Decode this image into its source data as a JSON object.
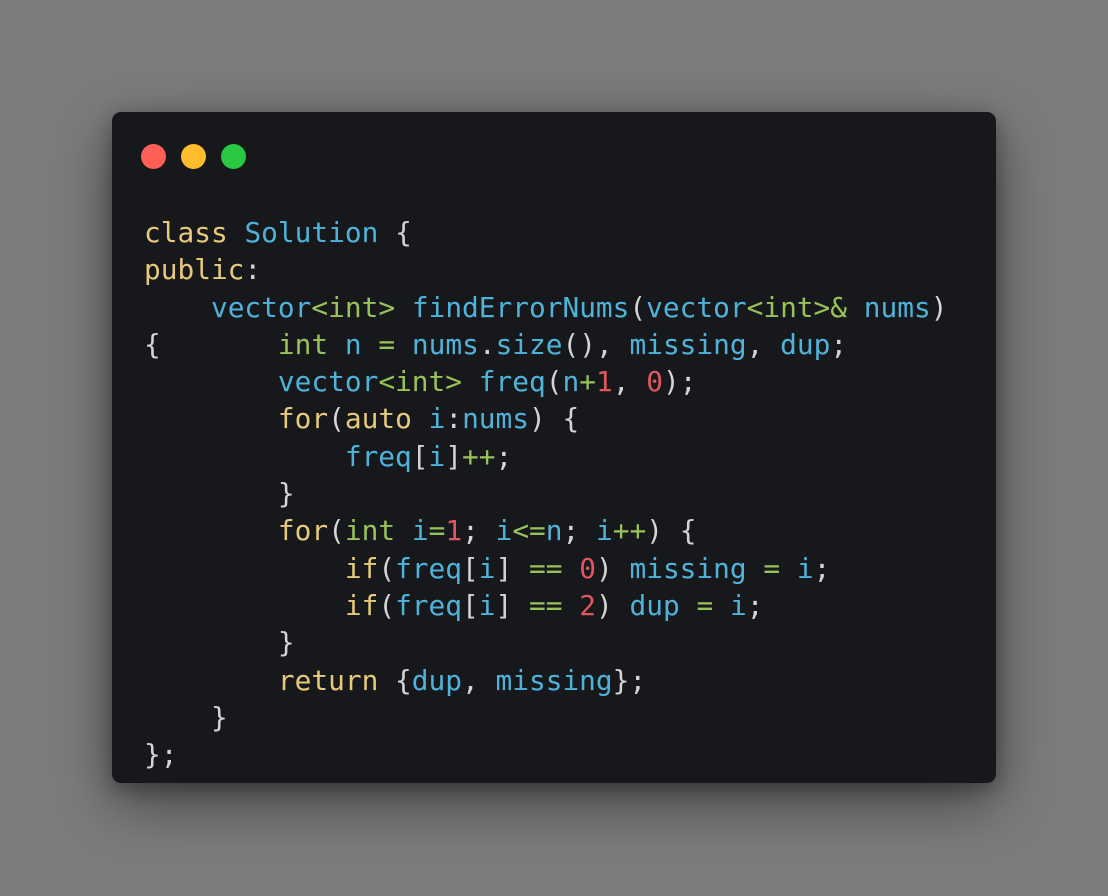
{
  "window": {
    "controls": [
      {
        "name": "close",
        "color": "#ff5f57"
      },
      {
        "name": "minimize",
        "color": "#febc2e"
      },
      {
        "name": "maximize",
        "color": "#28c840"
      }
    ]
  },
  "code": {
    "language": "cpp",
    "lines": [
      [
        [
          "kw",
          "class"
        ],
        [
          "pu",
          " "
        ],
        [
          "id",
          "Solution"
        ],
        [
          "pu",
          " {"
        ]
      ],
      [
        [
          "kw",
          "public"
        ],
        [
          "pu",
          ":"
        ]
      ],
      [
        [
          "pu",
          "    "
        ],
        [
          "id",
          "vector"
        ],
        [
          "op",
          "<"
        ],
        [
          "ty",
          "int"
        ],
        [
          "op",
          ">"
        ],
        [
          "pu",
          " "
        ],
        [
          "id",
          "findErrorNums"
        ],
        [
          "pu",
          "("
        ],
        [
          "id",
          "vector"
        ],
        [
          "op",
          "<"
        ],
        [
          "ty",
          "int"
        ],
        [
          "op",
          ">&"
        ],
        [
          "pu",
          " "
        ],
        [
          "id",
          "nums"
        ],
        [
          "pu",
          ")"
        ]
      ],
      [
        [
          "pu",
          "{       "
        ],
        [
          "ty",
          "int"
        ],
        [
          "pu",
          " "
        ],
        [
          "id",
          "n"
        ],
        [
          "pu",
          " "
        ],
        [
          "op",
          "="
        ],
        [
          "pu",
          " "
        ],
        [
          "id",
          "nums"
        ],
        [
          "pu",
          "."
        ],
        [
          "id",
          "size"
        ],
        [
          "pu",
          "(), "
        ],
        [
          "id",
          "missing"
        ],
        [
          "pu",
          ", "
        ],
        [
          "id",
          "dup"
        ],
        [
          "pu",
          ";"
        ]
      ],
      [
        [
          "pu",
          "        "
        ],
        [
          "id",
          "vector"
        ],
        [
          "op",
          "<"
        ],
        [
          "ty",
          "int"
        ],
        [
          "op",
          ">"
        ],
        [
          "pu",
          " "
        ],
        [
          "id",
          "freq"
        ],
        [
          "pu",
          "("
        ],
        [
          "id",
          "n"
        ],
        [
          "op",
          "+"
        ],
        [
          "num",
          "1"
        ],
        [
          "pu",
          ", "
        ],
        [
          "num",
          "0"
        ],
        [
          "pu",
          ");"
        ]
      ],
      [
        [
          "pu",
          "        "
        ],
        [
          "kw",
          "for"
        ],
        [
          "pu",
          "("
        ],
        [
          "kw",
          "auto"
        ],
        [
          "pu",
          " "
        ],
        [
          "id",
          "i"
        ],
        [
          "pu",
          ":"
        ],
        [
          "id",
          "nums"
        ],
        [
          "pu",
          ") {"
        ]
      ],
      [
        [
          "pu",
          "            "
        ],
        [
          "id",
          "freq"
        ],
        [
          "pu",
          "["
        ],
        [
          "id",
          "i"
        ],
        [
          "pu",
          "]"
        ],
        [
          "op",
          "++"
        ],
        [
          "pu",
          ";"
        ]
      ],
      [
        [
          "pu",
          "        }"
        ]
      ],
      [
        [
          "pu",
          "        "
        ],
        [
          "kw",
          "for"
        ],
        [
          "pu",
          "("
        ],
        [
          "ty",
          "int"
        ],
        [
          "pu",
          " "
        ],
        [
          "id",
          "i"
        ],
        [
          "op",
          "="
        ],
        [
          "num",
          "1"
        ],
        [
          "pu",
          "; "
        ],
        [
          "id",
          "i"
        ],
        [
          "op",
          "<="
        ],
        [
          "id",
          "n"
        ],
        [
          "pu",
          "; "
        ],
        [
          "id",
          "i"
        ],
        [
          "op",
          "++"
        ],
        [
          "pu",
          ") {"
        ]
      ],
      [
        [
          "pu",
          "            "
        ],
        [
          "kw",
          "if"
        ],
        [
          "pu",
          "("
        ],
        [
          "id",
          "freq"
        ],
        [
          "pu",
          "["
        ],
        [
          "id",
          "i"
        ],
        [
          "pu",
          "] "
        ],
        [
          "op",
          "=="
        ],
        [
          "pu",
          " "
        ],
        [
          "num",
          "0"
        ],
        [
          "pu",
          ") "
        ],
        [
          "id",
          "missing"
        ],
        [
          "pu",
          " "
        ],
        [
          "op",
          "="
        ],
        [
          "pu",
          " "
        ],
        [
          "id",
          "i"
        ],
        [
          "pu",
          ";"
        ]
      ],
      [
        [
          "pu",
          "            "
        ],
        [
          "kw",
          "if"
        ],
        [
          "pu",
          "("
        ],
        [
          "id",
          "freq"
        ],
        [
          "pu",
          "["
        ],
        [
          "id",
          "i"
        ],
        [
          "pu",
          "] "
        ],
        [
          "op",
          "=="
        ],
        [
          "pu",
          " "
        ],
        [
          "num",
          "2"
        ],
        [
          "pu",
          ") "
        ],
        [
          "id",
          "dup"
        ],
        [
          "pu",
          " "
        ],
        [
          "op",
          "="
        ],
        [
          "pu",
          " "
        ],
        [
          "id",
          "i"
        ],
        [
          "pu",
          ";"
        ]
      ],
      [
        [
          "pu",
          "        }"
        ]
      ],
      [
        [
          "pu",
          "        "
        ],
        [
          "kw",
          "return"
        ],
        [
          "pu",
          " {"
        ],
        [
          "id",
          "dup"
        ],
        [
          "pu",
          ", "
        ],
        [
          "id",
          "missing"
        ],
        [
          "pu",
          "};"
        ]
      ],
      [
        [
          "pu",
          "    }"
        ]
      ],
      [
        [
          "pu",
          "};"
        ]
      ]
    ]
  }
}
